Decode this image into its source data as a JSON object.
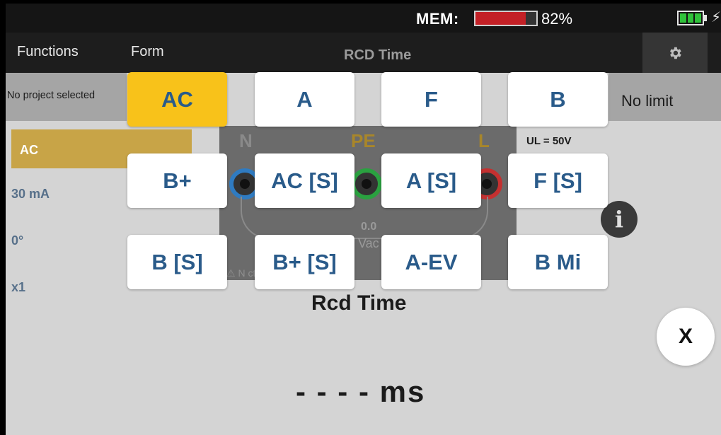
{
  "status": {
    "mem_label": "MEM:",
    "mem_percent": "82%",
    "mem_fill": 0.82,
    "mem_color": "#c32026",
    "battery_color": "#2fc23a",
    "plug_icon": "plug-icon"
  },
  "header": {
    "functions": "Functions",
    "form": "Form",
    "title": "RCD Time",
    "settings_icon": "gear-icon"
  },
  "project": {
    "text": "No project selected",
    "limit": "No limit"
  },
  "left_list": {
    "items": [
      "AC",
      "30 mA",
      "0°",
      "x1"
    ]
  },
  "panel": {
    "n_label": "N",
    "pe_label": "PE",
    "l_label": "L",
    "reading_value": "0.0",
    "reading_unit": "Vac",
    "note": "⚠ N        cted        d",
    "ul_label": "UL = 50V"
  },
  "measurement": {
    "title": "Rcd Time",
    "value": "- - - -",
    "unit": "ms"
  },
  "popup": {
    "options": [
      "AC",
      "A",
      "F",
      "B",
      "B+",
      "AC [S]",
      "A [S]",
      "F [S]",
      "B [S]",
      "B+ [S]",
      "A-EV",
      "B Mi"
    ],
    "selected": "AC",
    "selected_color": "#f8c21a",
    "text_color": "#2a5b8a"
  },
  "close_label": "X"
}
